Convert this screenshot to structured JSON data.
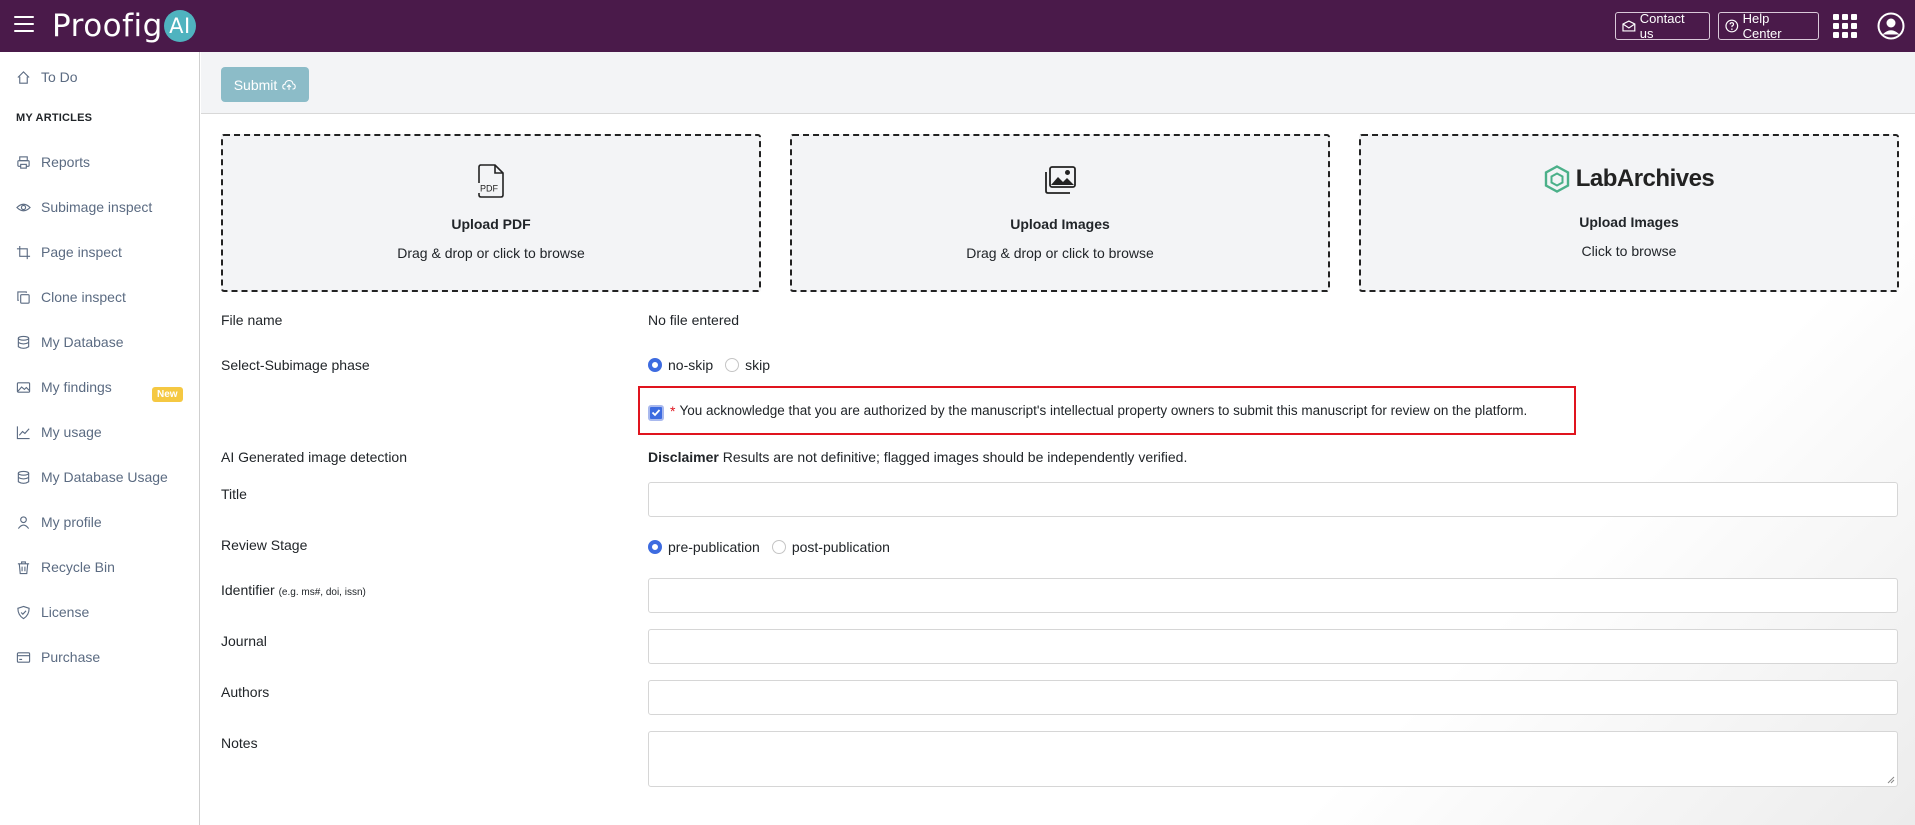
{
  "header": {
    "logo_text": "Proofig",
    "logo_ai": "AI",
    "contact_label": "Contact us",
    "help_label": "Help Center"
  },
  "sidebar": {
    "todo": "To Do",
    "section_heading": "MY ARTICLES",
    "items": [
      {
        "label": "Reports",
        "icon": "printer-icon"
      },
      {
        "label": "Subimage inspect",
        "icon": "eye-icon"
      },
      {
        "label": "Page inspect",
        "icon": "crop-icon"
      },
      {
        "label": "Clone inspect",
        "icon": "copy-icon"
      },
      {
        "label": "My Database",
        "icon": "database-icon",
        "badge": "New"
      },
      {
        "label": "My findings",
        "icon": "image-icon"
      },
      {
        "label": "My usage",
        "icon": "chart-line-icon"
      },
      {
        "label": "My Database Usage",
        "icon": "database-icon"
      },
      {
        "label": "My profile",
        "icon": "user-icon"
      },
      {
        "label": "Recycle Bin",
        "icon": "trash-icon"
      },
      {
        "label": "License",
        "icon": "shield-check-icon"
      },
      {
        "label": "Purchase",
        "icon": "credit-card-icon"
      }
    ]
  },
  "toolbar": {
    "submit_label": "Submit"
  },
  "uploads": {
    "pdf": {
      "title": "Upload PDF",
      "sub": "Drag & drop or click to browse",
      "icon_text": "PDF"
    },
    "images": {
      "title": "Upload Images",
      "sub": "Drag & drop or click to browse"
    },
    "labarchives": {
      "brand": "LabArchives",
      "title": "Upload Images",
      "sub": "Click to browse"
    }
  },
  "form": {
    "file_name_label": "File name",
    "file_name_value": "No file entered",
    "subimage_label": "Select-Subimage phase",
    "subimage_options": [
      "no-skip",
      "skip"
    ],
    "subimage_selected": "no-skip",
    "ack_star": "*",
    "ack_text": "You acknowledge that you are authorized by the manuscript's intellectual property owners to submit this manuscript for review on the platform.",
    "ack_checked": true,
    "ai_label": "AI Generated image detection",
    "disclaimer_bold": "Disclaimer",
    "disclaimer_text": "Results are not definitive; flagged images should be independently verified.",
    "title_label": "Title",
    "review_label": "Review Stage",
    "review_options": [
      "pre-publication",
      "post-publication"
    ],
    "review_selected": "pre-publication",
    "identifier_label": "Identifier",
    "identifier_hint": "(e.g. ms#, doi, issn)",
    "journal_label": "Journal",
    "authors_label": "Authors",
    "notes_label": "Notes"
  },
  "colors": {
    "topbar": "#4a1a4a",
    "accent": "#3d6be0",
    "submit": "#8cbcc8",
    "highlight": "#e0141e"
  }
}
